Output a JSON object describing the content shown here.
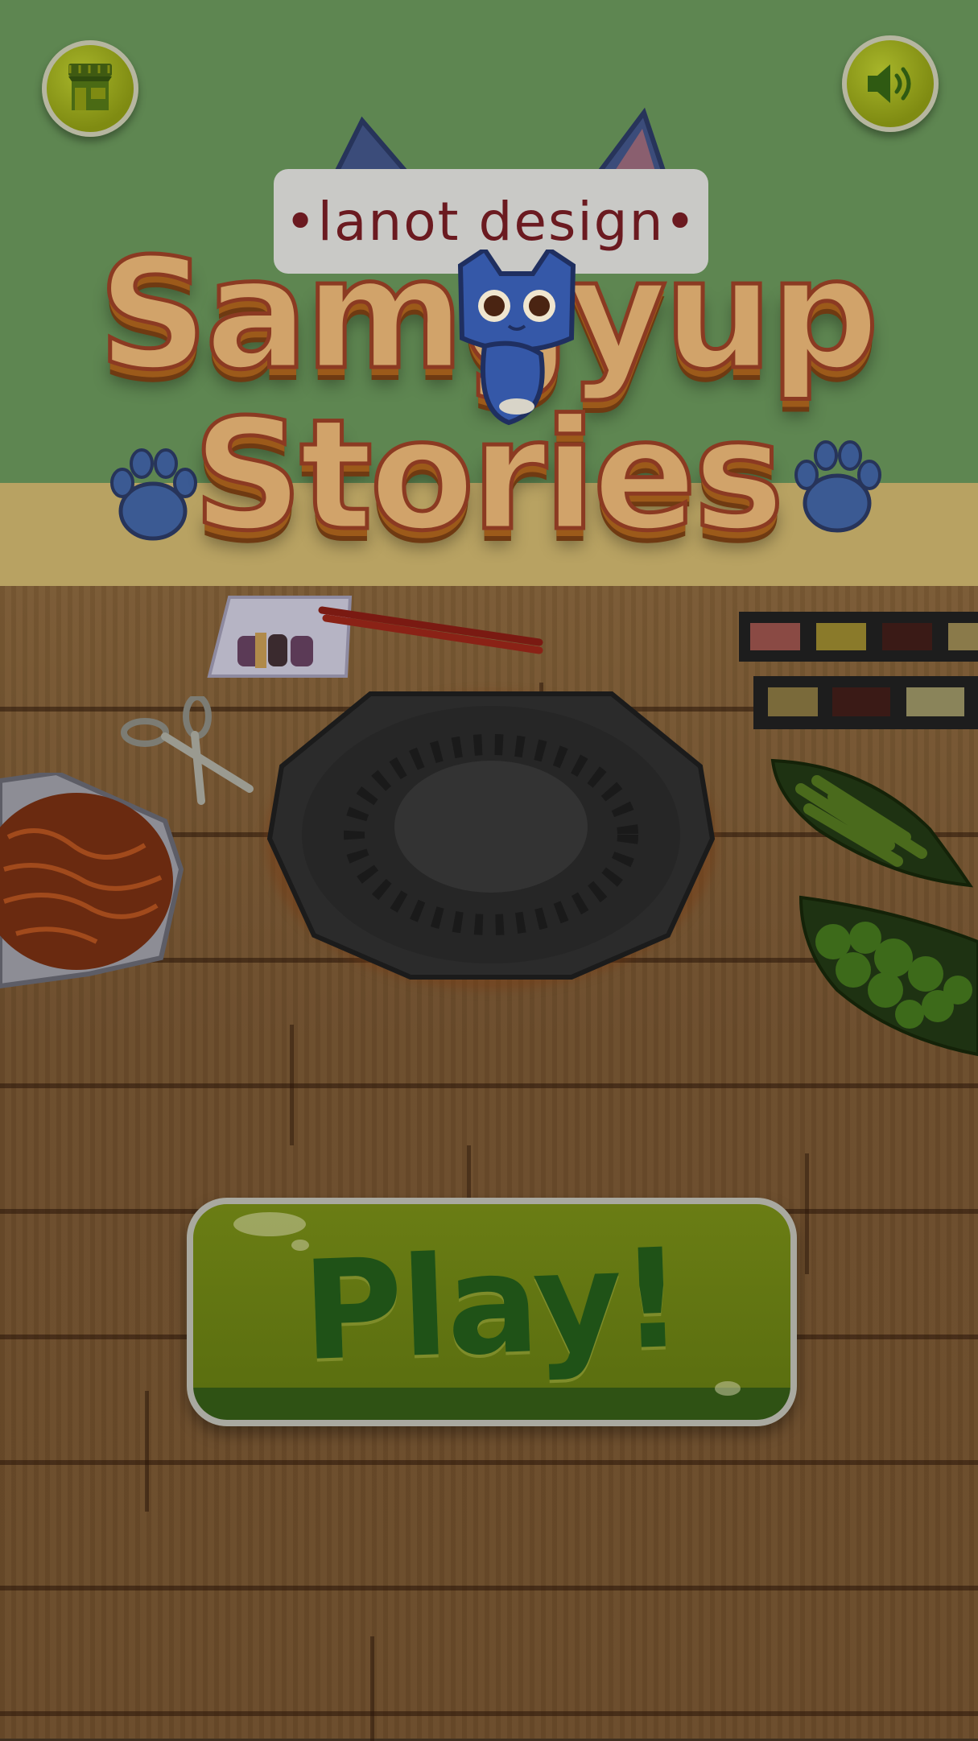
{
  "header": {
    "shop_icon": "shop-icon",
    "sound_icon": "speaker-icon"
  },
  "logo": {
    "brand": "•lanot design•",
    "title_line1": "Samgyup",
    "title_line2": "Stories"
  },
  "play_button": {
    "label": "Play!"
  },
  "colors": {
    "wall": "#5e8651",
    "button_green": "#6a7d14",
    "button_text": "#1f5217",
    "logo_text": "#d1a36a"
  }
}
